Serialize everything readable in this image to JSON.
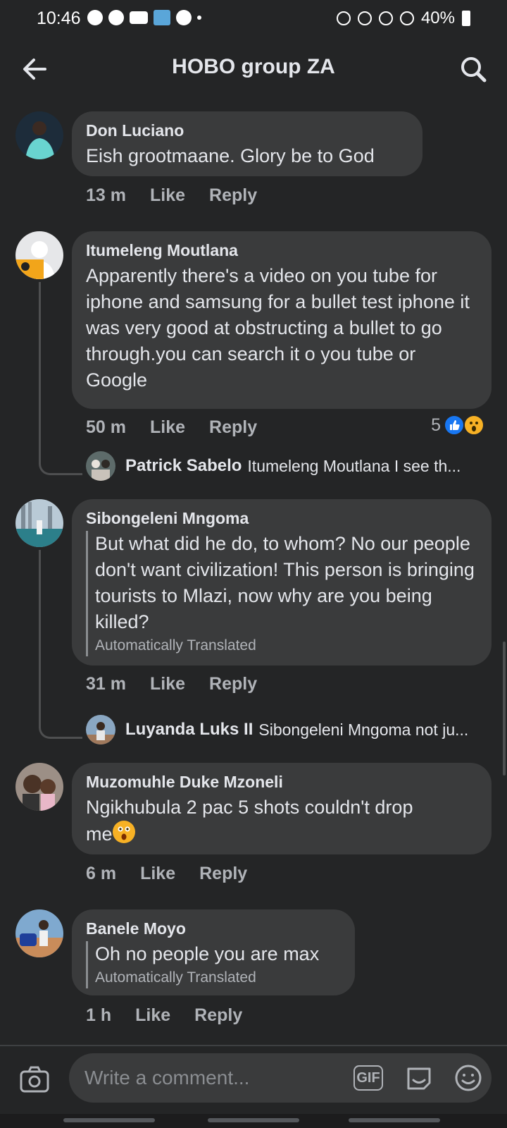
{
  "status_bar": {
    "time": "10:46",
    "battery": "40%"
  },
  "header": {
    "title": "HOBO group ZA"
  },
  "comments": [
    {
      "author": "Don Luciano",
      "text": "Eish grootmaane.  Glory be to God",
      "time": "13 m",
      "like": "Like",
      "reply": "Reply"
    },
    {
      "author": "Itumeleng Moutlana",
      "text": "Apparently there's a video on you tube for iphone and  samsung for a bullet test iphone it was very good at obstructing a bullet to go through.you can search it o you tube or Google",
      "time": "50 m",
      "like": "Like",
      "reply": "Reply",
      "reaction_count": "5",
      "reply_preview": {
        "author": "Patrick Sabelo",
        "text": "Itumeleng Moutlana I see th..."
      }
    },
    {
      "author": "Sibongeleni Mngoma",
      "text": "But what did he do, to whom? No our people don't want civilization! This person is bringing tourists to Mlazi, now why are you being killed?",
      "translation_note": "Automatically Translated",
      "time": "31 m",
      "like": "Like",
      "reply": "Reply",
      "reply_preview": {
        "author": "Luyanda Luks II",
        "text": "Sibongeleni Mngoma not ju..."
      }
    },
    {
      "author": "Muzomuhle Duke Mzoneli",
      "text_line1": "Ngikhubula 2 pac 5 shots couldn't drop",
      "text_line2": "me",
      "time": "6 m",
      "like": "Like",
      "reply": "Reply"
    },
    {
      "author": "Banele Moyo",
      "text": "Oh no people you are max",
      "translation_note": "Automatically Translated",
      "time": "1 h",
      "like": "Like",
      "reply": "Reply"
    }
  ],
  "composer": {
    "placeholder": "Write a comment...",
    "gif_label": "GIF"
  },
  "colors": {
    "background": "#242526",
    "bubble": "#3a3b3c",
    "like_blue": "#1877f2",
    "wow_yellow": "#f7b125"
  }
}
